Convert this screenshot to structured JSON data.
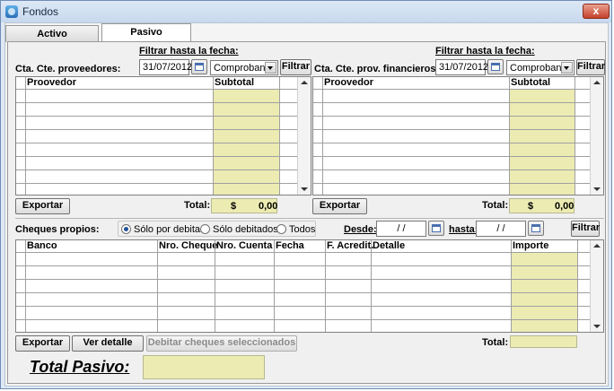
{
  "window": {
    "title": "Fondos",
    "close_label": "x"
  },
  "tabs": [
    {
      "label": "Activo"
    },
    {
      "label": "Pasivo"
    }
  ],
  "left": {
    "label": "Cta. Cte. proveedores:",
    "filter_label": "Filtrar hasta la fecha:",
    "date": "31/07/2012",
    "combo": "Comprobante",
    "filter_button": "Filtrar",
    "columns": [
      "Proovedor",
      "Subtotal"
    ],
    "export_button": "Exportar",
    "total_label": "Total:",
    "total_currency": "$",
    "total_value": "0,00"
  },
  "right": {
    "label": "Cta. Cte. prov. financieros:",
    "filter_label": "Filtrar hasta la fecha:",
    "date": "31/07/2012",
    "combo": "Comprobante",
    "filter_button": "Filtrar",
    "columns": [
      "Proovedor",
      "Subtotal"
    ],
    "export_button": "Exportar",
    "total_label": "Total:",
    "total_currency": "$",
    "total_value": "0,00"
  },
  "cheques": {
    "label": "Cheques propios:",
    "radios": [
      "Sólo por debitar",
      "Sólo debitados",
      "Todos"
    ],
    "selected_radio": "Sólo por debitar",
    "desde_label": "Desde:",
    "desde_value": "/ /",
    "hasta_label": "hasta:",
    "hasta_value": "/ /",
    "filter_button": "Filtrar",
    "columns": [
      "Banco",
      "Nro. Cheque",
      "Nro. Cuenta",
      "Fecha",
      "F. Acredit.",
      "Detalle",
      "Importe"
    ],
    "export_button": "Exportar",
    "detail_button": "Ver detalle",
    "debit_button": "Debitar cheques seleccionados",
    "total_label": "Total:"
  },
  "footer": {
    "total_pasivo_label": "Total Pasivo:"
  },
  "colors": {
    "highlight": "#ecebb2",
    "title_bar": "#c7d8ee"
  }
}
